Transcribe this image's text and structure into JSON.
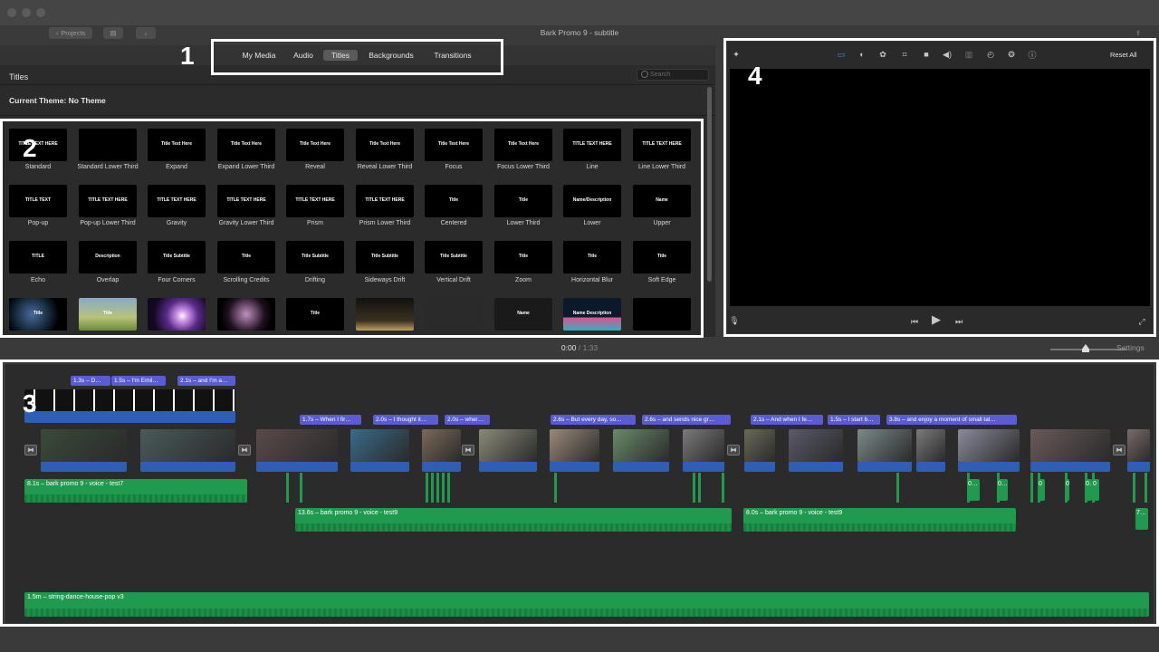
{
  "window": {
    "title": "Bark Promo 9 - subtitle",
    "projects_button": "Projects"
  },
  "browser": {
    "tabs": [
      "My Media",
      "Audio",
      "Titles",
      "Backgrounds",
      "Transitions"
    ],
    "active_tab": "Titles",
    "heading": "Titles",
    "search_placeholder": "Search",
    "theme_label": "Current Theme: No Theme",
    "title_tiles": [
      {
        "name": "Standard",
        "preview": "TITLE TEXT HERE"
      },
      {
        "name": "Standard Lower Third",
        "preview": ""
      },
      {
        "name": "Expand",
        "preview": "Title Text Here"
      },
      {
        "name": "Expand Lower Third",
        "preview": "Title Text Here"
      },
      {
        "name": "Reveal",
        "preview": "Title Text Here"
      },
      {
        "name": "Reveal Lower Third",
        "preview": "Title Text Here"
      },
      {
        "name": "Focus",
        "preview": "Title Text Here"
      },
      {
        "name": "Focus Lower Third",
        "preview": "Title Text Here"
      },
      {
        "name": "Line",
        "preview": "TITLE TEXT HERE"
      },
      {
        "name": "Line Lower Third",
        "preview": "TITLE TEXT HERE"
      },
      {
        "name": "Pop-up",
        "preview": "TITLE TEXT"
      },
      {
        "name": "Pop-up Lower Third",
        "preview": "TITLE TEXT HERE"
      },
      {
        "name": "Gravity",
        "preview": "TITLE TEXT HERE"
      },
      {
        "name": "Gravity Lower Third",
        "preview": "TITLE TEXT HERE"
      },
      {
        "name": "Prism",
        "preview": "TITLE TEXT HERE"
      },
      {
        "name": "Prism Lower Third",
        "preview": "TITLE TEXT HERE"
      },
      {
        "name": "Centered",
        "preview": "Title"
      },
      {
        "name": "Lower Third",
        "preview": "Title"
      },
      {
        "name": "Lower",
        "preview": "Name/Description"
      },
      {
        "name": "Upper",
        "preview": "Name"
      },
      {
        "name": "Echo",
        "preview": "TITLE"
      },
      {
        "name": "Overlap",
        "preview": "Description"
      },
      {
        "name": "Four Corners",
        "preview": "Title Subtitle"
      },
      {
        "name": "Scrolling Credits",
        "preview": "Title"
      },
      {
        "name": "Drifting",
        "preview": "Title Subtitle"
      },
      {
        "name": "Sideways Drift",
        "preview": "Title Subtitle"
      },
      {
        "name": "Vertical Drift",
        "preview": "Title Subtitle"
      },
      {
        "name": "Zoom",
        "preview": "Title"
      },
      {
        "name": "Horizontal Blur",
        "preview": "Title"
      },
      {
        "name": "Soft Edge",
        "preview": "Title"
      },
      {
        "name": "",
        "preview": "Title"
      },
      {
        "name": "",
        "preview": "Title"
      },
      {
        "name": "",
        "preview": ""
      },
      {
        "name": "",
        "preview": ""
      },
      {
        "name": "",
        "preview": "Title"
      },
      {
        "name": "",
        "preview": ""
      },
      {
        "name": "",
        "preview": ""
      },
      {
        "name": "",
        "preview": "Name"
      },
      {
        "name": "",
        "preview": "Name Description"
      },
      {
        "name": "",
        "preview": ""
      }
    ]
  },
  "viewer": {
    "reset_all": "Reset All"
  },
  "playhead": {
    "current": "0:00",
    "separator": "/",
    "duration": "1:33",
    "settings": "Settings"
  },
  "timeline": {
    "title_clips": [
      {
        "label": "1.3s – D…"
      },
      {
        "label": "1.5s – I'm Emil…"
      },
      {
        "label": "2.1s – and I'm a…"
      },
      {
        "label": "1.7s – When I fir…"
      },
      {
        "label": "2.0s – I thought it…"
      },
      {
        "label": "2.0s – wher…"
      },
      {
        "label": "2.6s – But every day, so…"
      },
      {
        "label": "2.6s – and sends nice gr…"
      },
      {
        "label": "2.1s – And when I fe…"
      },
      {
        "label": "1.5s – I start b…"
      },
      {
        "label": "3.8s – and enjoy a moment of small tal…"
      }
    ],
    "audio_clips": [
      {
        "label": "8.1s – bark promo 9 - voice - test7"
      },
      {
        "label": "13.6s – bark promo 9 - voice - test9"
      },
      {
        "label": "8.0s – bark promo 9 - voice - test9"
      },
      {
        "label": "1.5m – string-dance-house-pop v3"
      }
    ],
    "small_audio_labels": [
      "0…",
      "0…",
      "0",
      "0…",
      "0",
      "0",
      "7…"
    ]
  },
  "annotations": [
    "1",
    "2",
    "3",
    "4"
  ]
}
